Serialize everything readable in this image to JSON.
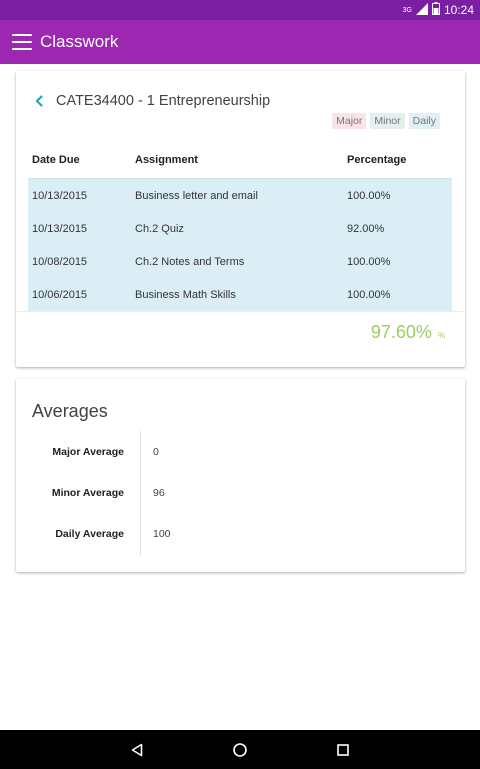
{
  "status_bar": {
    "network": "3G",
    "time": "10:24"
  },
  "app_bar": {
    "title": "Classwork"
  },
  "course": {
    "title": "CATE34400 - 1 Entrepreneurship",
    "legend": {
      "major": "Major",
      "minor": "Minor",
      "daily": "Daily"
    },
    "columns": {
      "date": "Date Due",
      "assignment": "Assignment",
      "percentage": "Percentage"
    },
    "rows": [
      {
        "date": "10/13/2015",
        "assignment": "Business letter and email",
        "percentage": "100.00%"
      },
      {
        "date": "10/13/2015",
        "assignment": "Ch.2 Quiz",
        "percentage": "92.00%"
      },
      {
        "date": "10/08/2015",
        "assignment": "Ch.2 Notes and Terms",
        "percentage": "100.00%"
      },
      {
        "date": "10/06/2015",
        "assignment": "Business Math Skills",
        "percentage": "100.00%"
      }
    ],
    "total": "97.60%",
    "total_unit": "%"
  },
  "averages": {
    "title": "Averages",
    "items": [
      {
        "label": "Major Average",
        "value": "0"
      },
      {
        "label": "Minor Average",
        "value": "96"
      },
      {
        "label": "Daily Average",
        "value": "100"
      }
    ]
  },
  "colors": {
    "app_bar": "#9c27b0",
    "status_bar": "#7b1fa2",
    "row_bg": "#dbeef6",
    "total": "#9ccc65",
    "back_icon": "#26a6b3"
  }
}
